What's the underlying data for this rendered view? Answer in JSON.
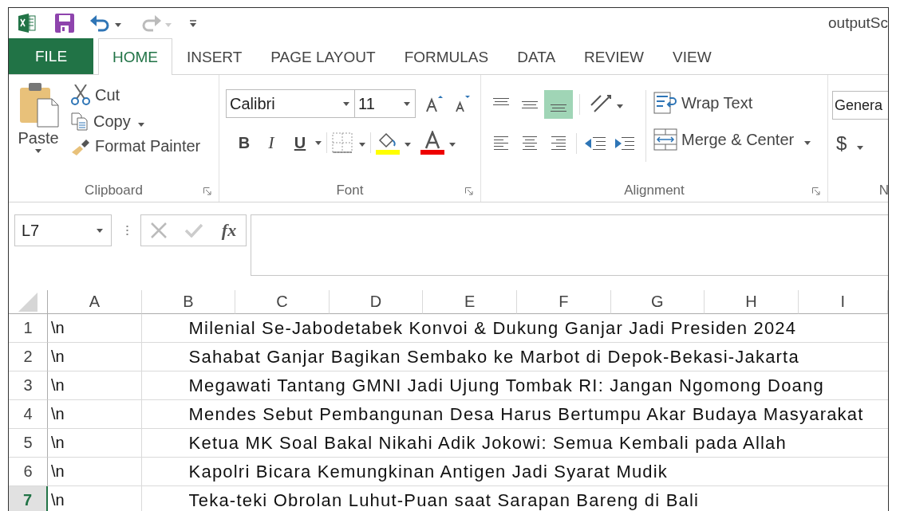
{
  "window": {
    "title": "outputSc"
  },
  "tabs": [
    {
      "label": "FILE",
      "kind": "file",
      "selected": false
    },
    {
      "label": "HOME",
      "kind": "tab",
      "selected": true
    },
    {
      "label": "INSERT",
      "kind": "tab",
      "selected": false
    },
    {
      "label": "PAGE LAYOUT",
      "kind": "tab",
      "selected": false
    },
    {
      "label": "FORMULAS",
      "kind": "tab",
      "selected": false
    },
    {
      "label": "DATA",
      "kind": "tab",
      "selected": false
    },
    {
      "label": "REVIEW",
      "kind": "tab",
      "selected": false
    },
    {
      "label": "VIEW",
      "kind": "tab",
      "selected": false
    }
  ],
  "ribbon": {
    "clipboard": {
      "label": "Clipboard",
      "paste": "Paste",
      "cut": "Cut",
      "copy": "Copy",
      "format_painter": "Format Painter"
    },
    "font": {
      "label": "Font",
      "family": "Calibri",
      "size": "11",
      "bold": "B",
      "italic": "I",
      "underline": "U"
    },
    "alignment": {
      "label": "Alignment",
      "vertical_align": [
        {
          "selected": false
        },
        {
          "selected": false
        },
        {
          "selected": true
        }
      ],
      "wrap_text": "Wrap Text",
      "merge_center": "Merge & Center"
    },
    "number": {
      "label": "N",
      "format": "Genera",
      "currency": "$"
    }
  },
  "formula_bar": {
    "name_box": "L7",
    "function": "fx"
  },
  "columns": [
    "A",
    "B",
    "C",
    "D",
    "E",
    "F",
    "G",
    "H",
    "I"
  ],
  "rows": [
    {
      "number": "1",
      "col_a": "\\n",
      "col_b": "Milenial Se-Jabodetabek Konvoi & Dukung Ganjar Jadi Presiden 2024",
      "selected": false
    },
    {
      "number": "2",
      "col_a": "\\n",
      "col_b": "Sahabat Ganjar Bagikan Sembako ke Marbot di Depok-Bekasi-Jakarta",
      "selected": false
    },
    {
      "number": "3",
      "col_a": "\\n",
      "col_b": "Megawati Tantang GMNI Jadi Ujung Tombak RI: Jangan Ngomong Doang",
      "selected": false
    },
    {
      "number": "4",
      "col_a": "\\n",
      "col_b": "Mendes Sebut Pembangunan Desa Harus Bertumpu Akar Budaya Masyarakat",
      "selected": false
    },
    {
      "number": "5",
      "col_a": "\\n",
      "col_b": "Ketua MK Soal Bakal Nikahi Adik Jokowi: Semua Kembali pada Allah",
      "selected": false
    },
    {
      "number": "6",
      "col_a": "\\n",
      "col_b": "Kapolri Bicara Kemungkinan Antigen Jadi Syarat Mudik",
      "selected": false
    },
    {
      "number": "7",
      "col_a": "\\n",
      "col_b": "Teka-teki Obrolan Luhut-Puan saat Sarapan Bareng di Bali",
      "selected": true
    }
  ]
}
